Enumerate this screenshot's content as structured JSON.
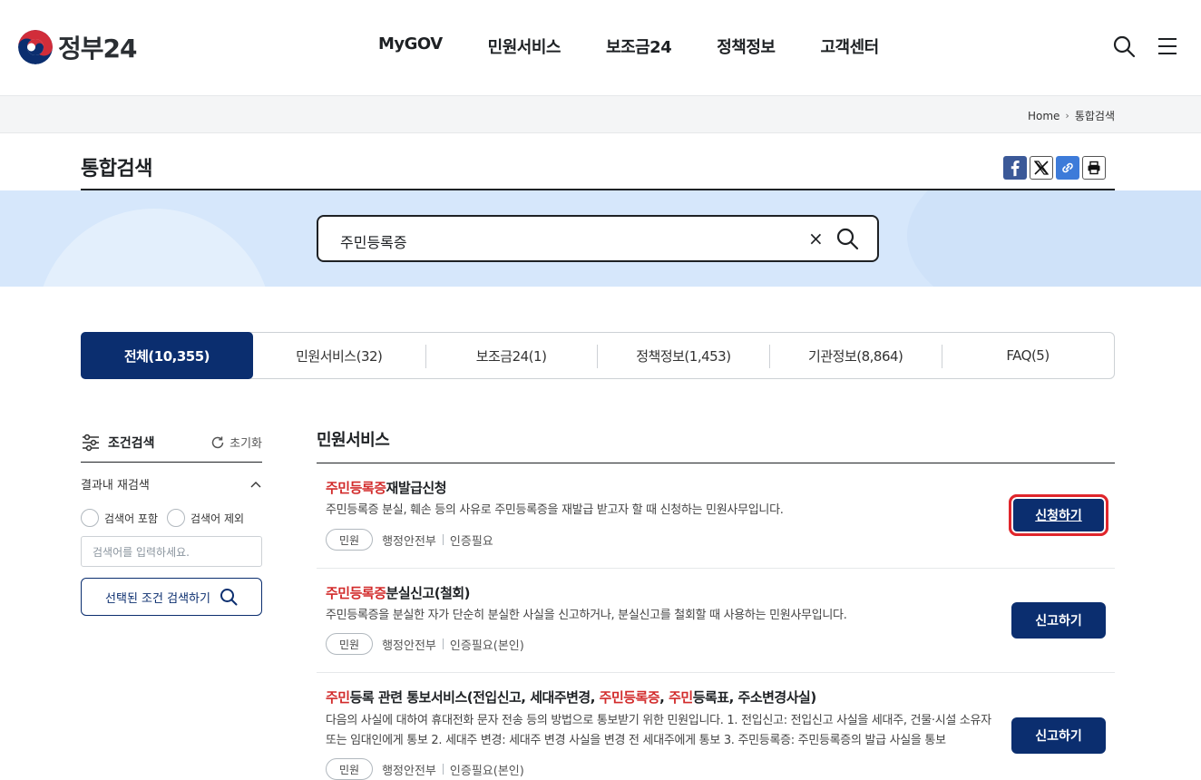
{
  "header": {
    "logo_text": "정부24",
    "nav": [
      "MyGOV",
      "민원서비스",
      "보조금24",
      "정책정보",
      "고객센터"
    ]
  },
  "breadcrumb": {
    "home": "Home",
    "current": "통합검색"
  },
  "page": {
    "title": "통합검색"
  },
  "search": {
    "query": "주민등록증",
    "clear": "×"
  },
  "tabs": [
    {
      "label": "전체(10,355)",
      "active": true
    },
    {
      "label": "민원서비스(32)"
    },
    {
      "label": "보조금24(1)"
    },
    {
      "label": "정책정보(1,453)"
    },
    {
      "label": "기관정보(8,864)"
    },
    {
      "label": "FAQ(5)"
    }
  ],
  "sidebar": {
    "title": "조건검색",
    "reset": "초기화",
    "subtitle": "결과내 재검색",
    "radio_include": "검색어 포함",
    "radio_exclude": "검색어 제외",
    "input_placeholder": "검색어를 입력하세요.",
    "submit": "선택된 조건 검색하기"
  },
  "results_section": {
    "title": "민원서비스"
  },
  "results": [
    {
      "title_hl": "주민등록증",
      "title_rest": "재발급신청",
      "desc": "주민등록증 분실, 훼손 등의 사유로 주민등록증을 재발급 받고자 할 때 신청하는 민원사무입니다.",
      "badge": "민원",
      "org": "행정안전부",
      "cert": "인증필요",
      "button": "신청하기"
    },
    {
      "title_hl": "주민등록증",
      "title_rest": "분실신고(철회)",
      "desc": "주민등록증을 분실한 자가 단순히 분실한 사실을 신고하거나, 분실신고를 철회할 때 사용하는 민원사무입니다.",
      "badge": "민원",
      "org": "행정안전부",
      "cert": "인증필요(본인)",
      "button": "신고하기"
    },
    {
      "title_p1": "주민",
      "title_p2": "등록 관련 통보서비스(전입신고, 세대주변경, ",
      "title_p3": "주민등록증",
      "title_p4": ", ",
      "title_p5": "주민",
      "title_p6": "등록표, 주소변경사실)",
      "desc": "다음의 사실에 대하여 휴대전화 문자 전송 등의 방법으로 통보받기 위한 민원입니다. 1. 전입신고: 전입신고 사실을 세대주, 건물·시설 소유자 또는 임대인에게 통보 2. 세대주 변경: 세대주 변경 사실을 변경 전 세대주에게 통보 3. 주민등록증: 주민등록증의 발급 사실을 통보",
      "badge": "민원",
      "org": "행정안전부",
      "cert": "인증필요(본인)",
      "button": "신고하기"
    }
  ],
  "colors": {
    "primary": "#0b2e6f",
    "highlight": "#d22b2b",
    "focus": "#e0262c"
  }
}
